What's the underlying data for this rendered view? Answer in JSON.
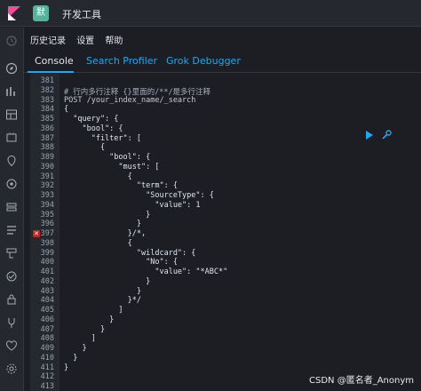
{
  "header": {
    "app_badge": "默",
    "title": "开发工具"
  },
  "top_links": [
    "历史记录",
    "设置",
    "帮助"
  ],
  "tabs": [
    {
      "label": "Console",
      "active": true
    },
    {
      "label": "Search Profiler",
      "active": false
    },
    {
      "label": "Grok Debugger",
      "active": false
    }
  ],
  "editor": {
    "lines": [
      {
        "n": "381",
        "t": ""
      },
      {
        "n": "382",
        "t": "# 行内多行注释 {}里面的/**/是多行注释"
      },
      {
        "n": "383",
        "t": "POST /your_index_name/_search"
      },
      {
        "n": "384",
        "t": "{"
      },
      {
        "n": "385",
        "t": "  \"query\": {"
      },
      {
        "n": "386",
        "t": "    \"bool\": {"
      },
      {
        "n": "387",
        "t": "      \"filter\": ["
      },
      {
        "n": "388",
        "t": "        {"
      },
      {
        "n": "389",
        "t": "          \"bool\": {"
      },
      {
        "n": "390",
        "t": "            \"must\": ["
      },
      {
        "n": "391",
        "t": "              {"
      },
      {
        "n": "392",
        "t": "                \"term\": {"
      },
      {
        "n": "393",
        "t": "                  \"SourceType\": {"
      },
      {
        "n": "394",
        "t": "                    \"value\": 1"
      },
      {
        "n": "395",
        "t": "                  }"
      },
      {
        "n": "396",
        "t": "                }"
      },
      {
        "n": "397",
        "t": "              }/*,"
      },
      {
        "n": "398",
        "t": "              {"
      },
      {
        "n": "399",
        "t": "                \"wildcard\": {"
      },
      {
        "n": "400",
        "t": "                  \"No\": {"
      },
      {
        "n": "401",
        "t": "                    \"value\": \"*ABC*\""
      },
      {
        "n": "402",
        "t": "                  }"
      },
      {
        "n": "403",
        "t": "                }"
      },
      {
        "n": "404",
        "t": "              }*/"
      },
      {
        "n": "405",
        "t": "            ]"
      },
      {
        "n": "406",
        "t": "          }"
      },
      {
        "n": "407",
        "t": "        }"
      },
      {
        "n": "408",
        "t": "      ]"
      },
      {
        "n": "409",
        "t": "    }"
      },
      {
        "n": "410",
        "t": "  }"
      },
      {
        "n": "411",
        "t": "}"
      },
      {
        "n": "412",
        "t": ""
      },
      {
        "n": "413",
        "t": ""
      }
    ],
    "error_line": "397"
  },
  "watermark": "CSDN @匿名者_Anonym",
  "colors": {
    "accent": "#1ba9f5",
    "background": "#1d1e24",
    "error": "#bd271e"
  }
}
